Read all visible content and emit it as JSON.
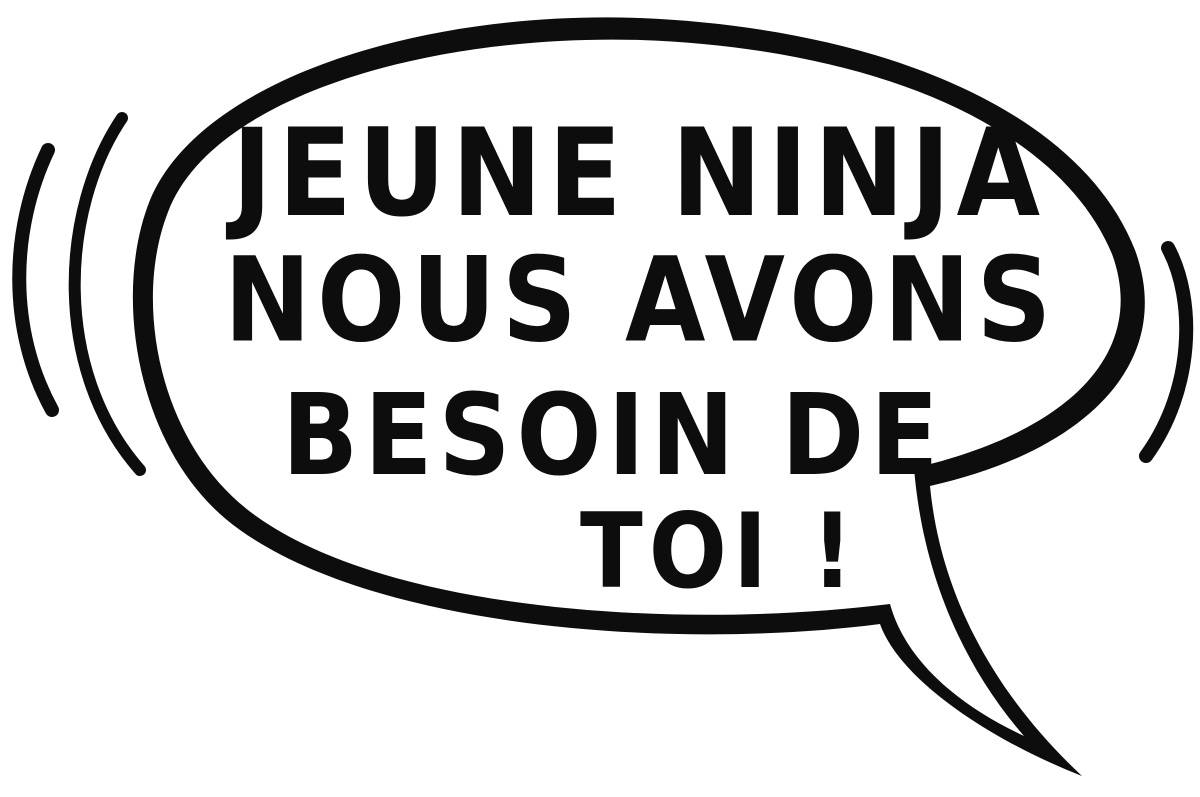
{
  "speech_bubble": {
    "lines": [
      "JEUNE NINJA",
      "NOUS AVONS",
      "BESOIN DE",
      "TOI !"
    ]
  },
  "colors": {
    "ink": "#0d0d0d",
    "fill": "#ffffff"
  }
}
